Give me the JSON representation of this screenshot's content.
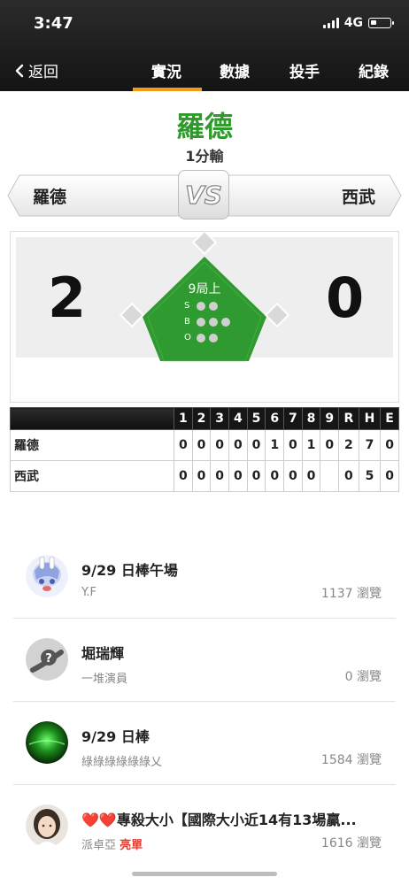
{
  "status_bar": {
    "time": "3:47",
    "network": "4G"
  },
  "nav": {
    "back_label": "返回",
    "tabs": [
      {
        "label": "實況",
        "active": true
      },
      {
        "label": "數據",
        "active": false
      },
      {
        "label": "投手",
        "active": false
      },
      {
        "label": "紀錄",
        "active": false
      }
    ],
    "accent_color": "#f29a1a"
  },
  "game": {
    "winner": "羅德",
    "result_text": "1分輸",
    "vs_label": "VS",
    "away_team": "羅德",
    "home_team": "西武",
    "away_score": "2",
    "home_score": "0",
    "inning_text": "9局上",
    "count": {
      "strikes": 2,
      "balls": 3,
      "outs": 2,
      "s_label": "S",
      "b_label": "B",
      "o_label": "O"
    },
    "field_color": "#2f9a2f"
  },
  "linescore": {
    "headers": [
      "1",
      "2",
      "3",
      "4",
      "5",
      "6",
      "7",
      "8",
      "9",
      "R",
      "H",
      "E"
    ],
    "rows": [
      {
        "team": "羅德",
        "cells": [
          "0",
          "0",
          "0",
          "0",
          "0",
          "1",
          "0",
          "1",
          "0",
          "2",
          "7",
          "0"
        ]
      },
      {
        "team": "西武",
        "cells": [
          "0",
          "0",
          "0",
          "0",
          "0",
          "0",
          "0",
          "0",
          "",
          "0",
          "5",
          "0"
        ]
      }
    ]
  },
  "posts": [
    {
      "title": "9/29 日棒午場",
      "author": "Y.F",
      "views": "1137 瀏覽",
      "avatar": "anime-avatar"
    },
    {
      "title": "堀瑞輝",
      "author": "一堆演員",
      "views": "0 瀏覽",
      "avatar": "default-avatar"
    },
    {
      "title": "9/29 日棒",
      "author": "綠綠綠綠綠綠乂",
      "views": "1584 瀏覽",
      "avatar": "green-light-avatar"
    },
    {
      "title_prefix": "❤️❤️",
      "title": "專殺大小【國際大小近14有13場贏...",
      "author": "派卓亞",
      "flag": "亮單",
      "views": "1616 瀏覽",
      "avatar": "photo-avatar"
    }
  ]
}
